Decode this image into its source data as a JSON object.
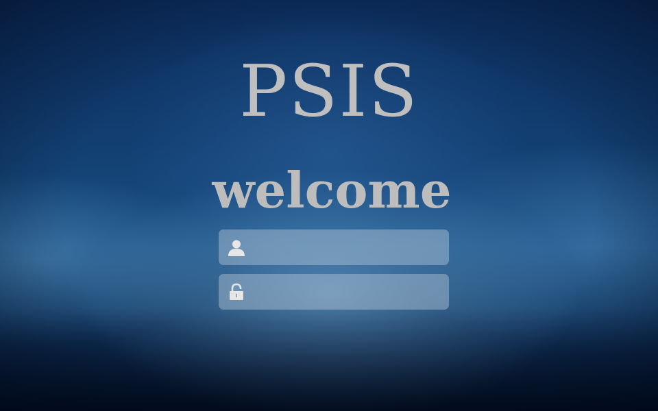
{
  "app": {
    "logo_text": "PSIS",
    "welcome_text": "welcome"
  },
  "login": {
    "username": {
      "icon": "user-icon",
      "value": "",
      "placeholder": ""
    },
    "password": {
      "icon": "lock-icon",
      "value": "",
      "placeholder": ""
    }
  },
  "colors": {
    "text_gray": "#bfbfbf",
    "background_blue": "#0b2a55",
    "field_fill": "rgba(190,205,220,0.42)"
  }
}
